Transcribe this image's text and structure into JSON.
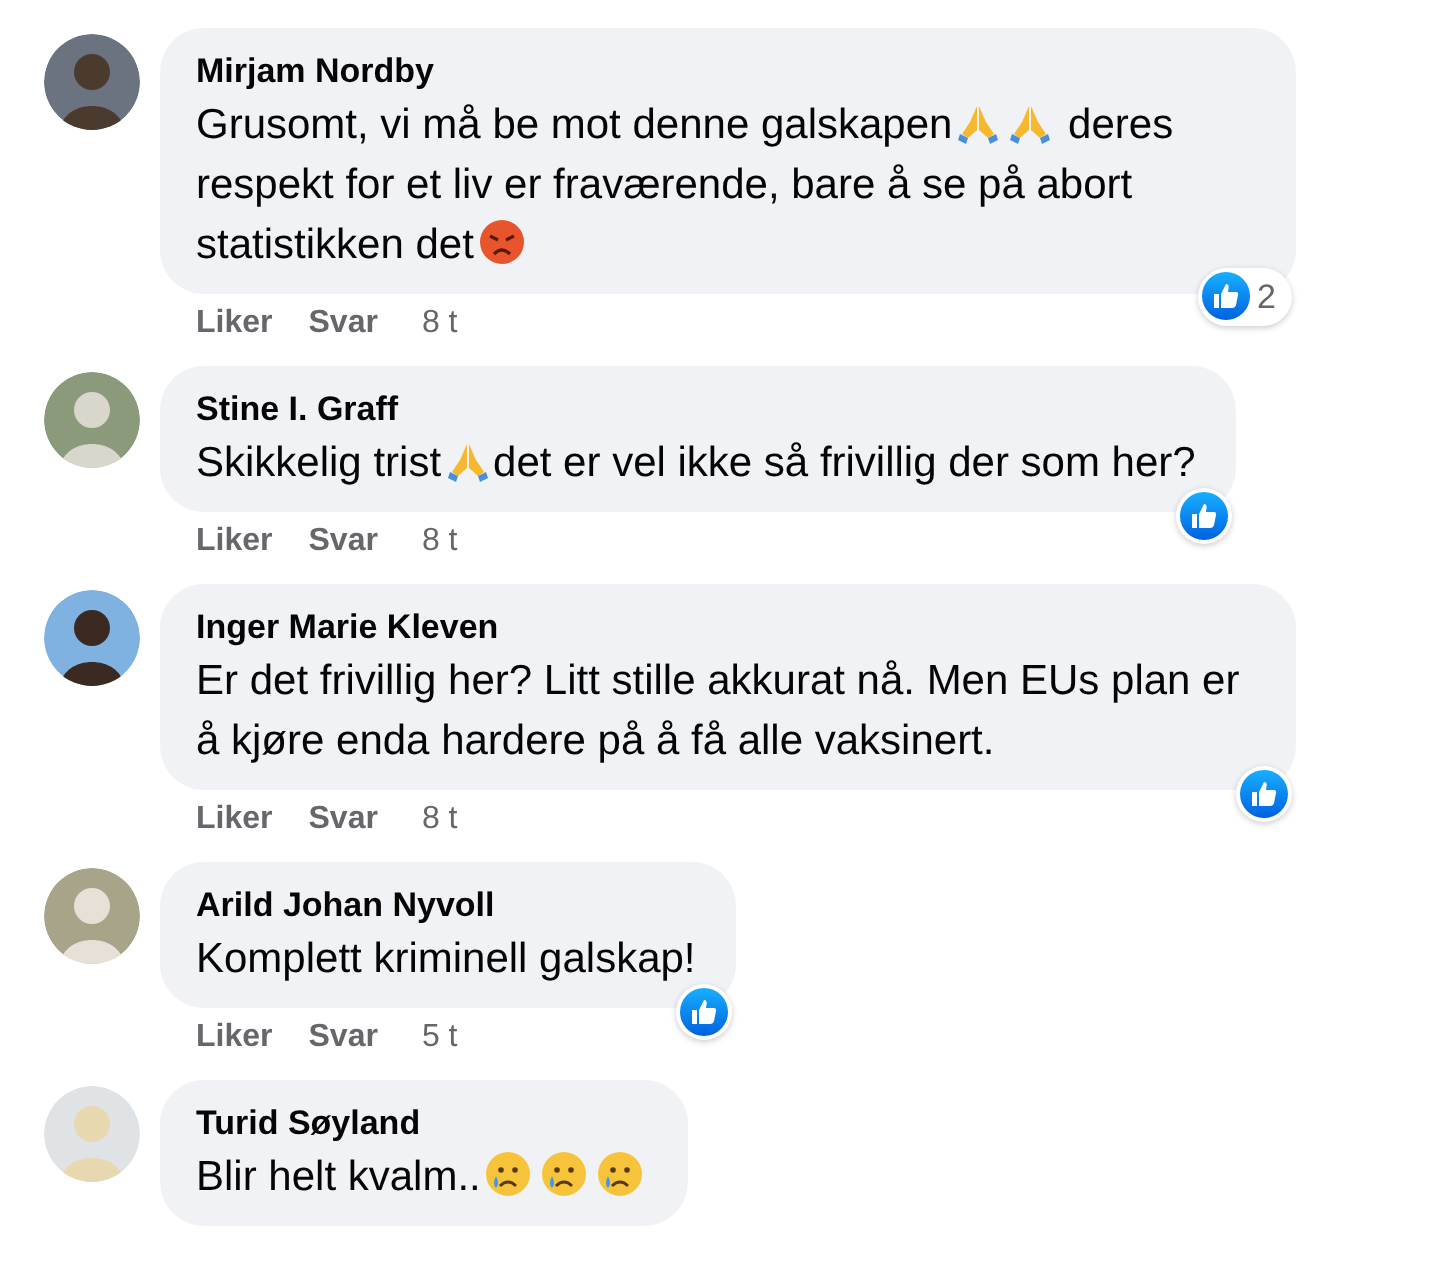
{
  "comments": [
    {
      "author": "Mirjam Nordby",
      "body": [
        {
          "kind": "text",
          "text": "Grusomt, vi må be mot denne galskapen"
        },
        {
          "kind": "pray"
        },
        {
          "kind": "pray"
        },
        {
          "kind": "text",
          "text": " deres respekt for et liv er fraværende, bare å se på abort statistikken det"
        },
        {
          "kind": "angry"
        }
      ],
      "liked": true,
      "like_count": "2",
      "actions": [
        "Liker",
        "Svar"
      ],
      "time": "8 t"
    },
    {
      "author": "Stine I. Graff",
      "body": [
        {
          "kind": "text",
          "text": "Skikkelig trist"
        },
        {
          "kind": "pray"
        },
        {
          "kind": "text",
          "text": "det er vel ikke så frivillig der som her?"
        }
      ],
      "liked": true,
      "actions": [
        "Liker",
        "Svar"
      ],
      "time": "8 t"
    },
    {
      "author": "Inger Marie Kleven",
      "body": [
        {
          "kind": "text",
          "text": "Er det frivillig her? Litt stille akkurat nå. Men EUs plan er å kjøre enda hardere på å få alle vaksinert."
        }
      ],
      "liked": true,
      "actions": [
        "Liker",
        "Svar"
      ],
      "time": "8 t"
    },
    {
      "author": "Arild Johan Nyvoll",
      "body": [
        {
          "kind": "text",
          "text": "Komplett kriminell galskap!"
        }
      ],
      "liked": true,
      "actions": [
        "Liker",
        "Svar"
      ],
      "time": "5 t"
    },
    {
      "author": "Turid Søyland",
      "body": [
        {
          "kind": "text",
          "text": "Blir helt kvalm.."
        },
        {
          "kind": "crying"
        },
        {
          "kind": "crying"
        },
        {
          "kind": "crying"
        }
      ],
      "liked": false
    }
  ]
}
